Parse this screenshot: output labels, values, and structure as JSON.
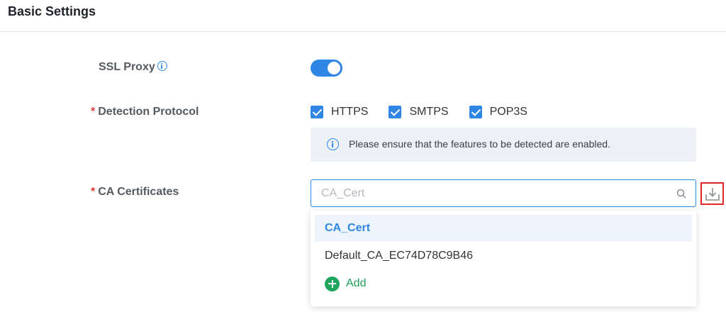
{
  "header": {
    "title": "Basic Settings"
  },
  "form": {
    "ssl_proxy": {
      "label": "SSL Proxy",
      "enabled": true
    },
    "detection_protocol": {
      "required_mark": "*",
      "label": "Detection Protocol",
      "options": [
        {
          "label": "HTTPS",
          "checked": true
        },
        {
          "label": "SMTPS",
          "checked": true
        },
        {
          "label": "POP3S",
          "checked": true
        }
      ],
      "notice": "Please ensure that the features to be detected are enabled."
    },
    "ca_certificates": {
      "required_mark": "*",
      "label": "CA Certificates",
      "placeholder": "CA_Cert",
      "dropdown": {
        "options": [
          "CA_Cert",
          "Default_CA_EC74D78C9B46"
        ],
        "selected": "CA_Cert",
        "add_label": "Add"
      }
    }
  },
  "colors": {
    "accent": "#2f86e5",
    "required": "#e33b3b",
    "add": "#22a65e",
    "highlight_border": "#e0242a"
  },
  "icons": [
    "info-icon",
    "search-icon",
    "download-icon",
    "add-icon",
    "check-icon"
  ]
}
